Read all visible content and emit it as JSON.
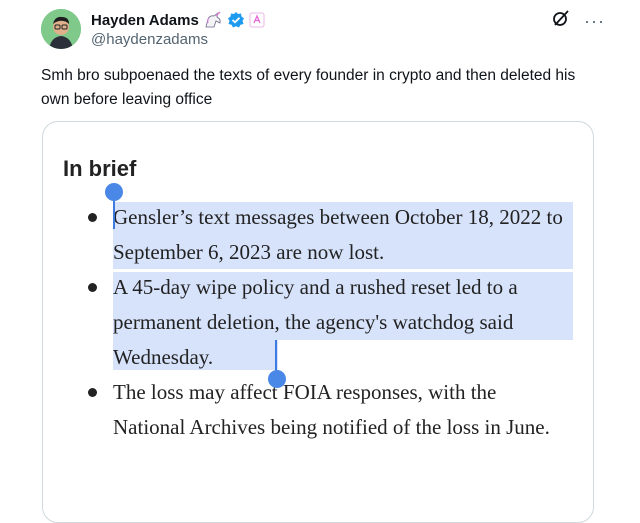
{
  "author": {
    "name": "Hayden Adams",
    "handle": "@haydenzadams"
  },
  "badges": [
    "unicorn-icon",
    "verified-badge-icon",
    "affiliate-badge-icon"
  ],
  "icons": [
    "grok-icon",
    "more-icon"
  ],
  "tweet": {
    "text": "Smh bro subpoenaed the texts of every founder in crypto and then deleted his own before leaving office"
  },
  "card": {
    "title": "In brief",
    "bullets": [
      "Gensler’s text messages between October 18, 2022 to September 6, 2023 are now lost.",
      "A 45-day wipe policy and a rushed reset led to a permanent deletion, the agency's watchdog said Wednesday.",
      "The loss may affect FOIA responses, with the National Archives being notified of the loss in June."
    ]
  },
  "colors": {
    "selection": "#d7e3fb",
    "handle_blue": "#4a88e8",
    "verified": "#1d9bf0",
    "avatar_bg": "#7fc98a"
  }
}
